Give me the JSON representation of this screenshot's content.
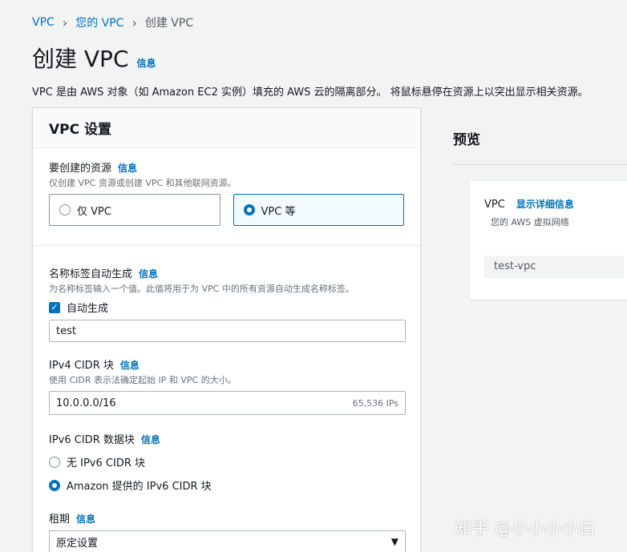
{
  "breadcrumb": {
    "root": "VPC",
    "parent": "您的 VPC",
    "current": "创建 VPC",
    "sep": "›"
  },
  "page": {
    "title": "创建 VPC",
    "info": "信息",
    "description": "VPC 是由 AWS 对象（如 Amazon EC2 实例）填充的 AWS 云的隔离部分。 将鼠标悬停在资源上以突出显示相关资源。"
  },
  "settings": {
    "title": "VPC 设置",
    "resources": {
      "label": "要创建的资源",
      "info": "信息",
      "desc": "仅创建 VPC 资源或创建 VPC 和其他联网资源。",
      "options": [
        "仅 VPC",
        "VPC 等"
      ],
      "selected": "VPC 等"
    },
    "name_tag": {
      "label": "名称标签自动生成",
      "info": "信息",
      "desc": "为名称标签输入一个值。此值将用于为 VPC 中的所有资源自动生成名称标签。",
      "checkbox_label": "自动生成",
      "checked": true,
      "value": "test"
    },
    "ipv4": {
      "label": "IPv4 CIDR 块",
      "info": "信息",
      "desc": "使用 CIDR 表示法确定起始 IP 和 VPC 的大小。",
      "value": "10.0.0.0/16",
      "suffix": "65,536 IPs"
    },
    "ipv6": {
      "label": "IPv6 CIDR 数据块",
      "info": "信息",
      "options": [
        "无 IPv6 CIDR 块",
        "Amazon 提供的 IPv6 CIDR 块"
      ],
      "selected": "Amazon 提供的 IPv6 CIDR 块"
    },
    "tenancy": {
      "label": "租期",
      "info": "信息",
      "value": "原定设置",
      "arrow": "▼"
    }
  },
  "preview": {
    "title": "预览",
    "vpc_label": "VPC",
    "details_link": "显示详细信息",
    "desc": "您的 AWS 虚拟网络",
    "vpc_name": "test-vpc"
  },
  "watermark": "知乎 @小小小小白",
  "colors": {
    "accent": "#0073bb",
    "text": "#16191f",
    "muted": "#687078",
    "bg": "#f2f3f3"
  }
}
